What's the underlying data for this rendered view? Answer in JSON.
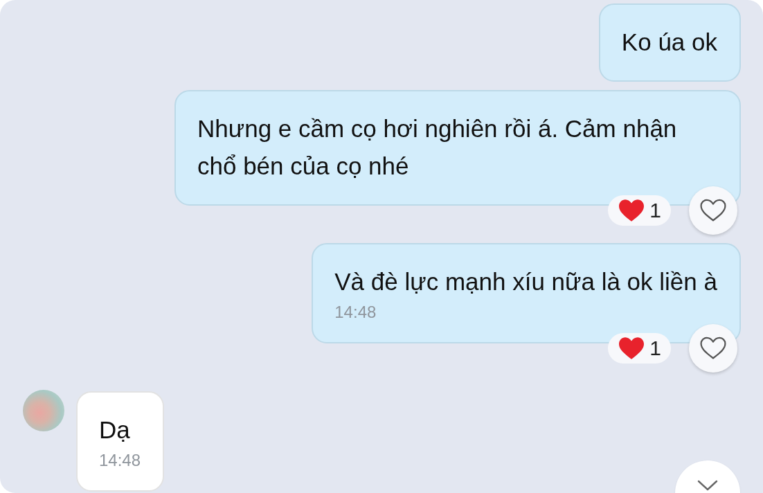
{
  "messages": [
    {
      "kind": "sent",
      "text": "Ko úa ok"
    },
    {
      "kind": "sent",
      "text": "Nhưng e cầm cọ hơi nghiên rồi á. Cảm nhận chổ bén của cọ nhé",
      "reaction": {
        "count": "1"
      }
    },
    {
      "kind": "sent",
      "text": "Và đè lực mạnh xíu nữa là ok liền à",
      "time": "14:48",
      "reaction": {
        "count": "1"
      }
    },
    {
      "kind": "received",
      "text": "Dạ",
      "time": "14:48"
    }
  ]
}
